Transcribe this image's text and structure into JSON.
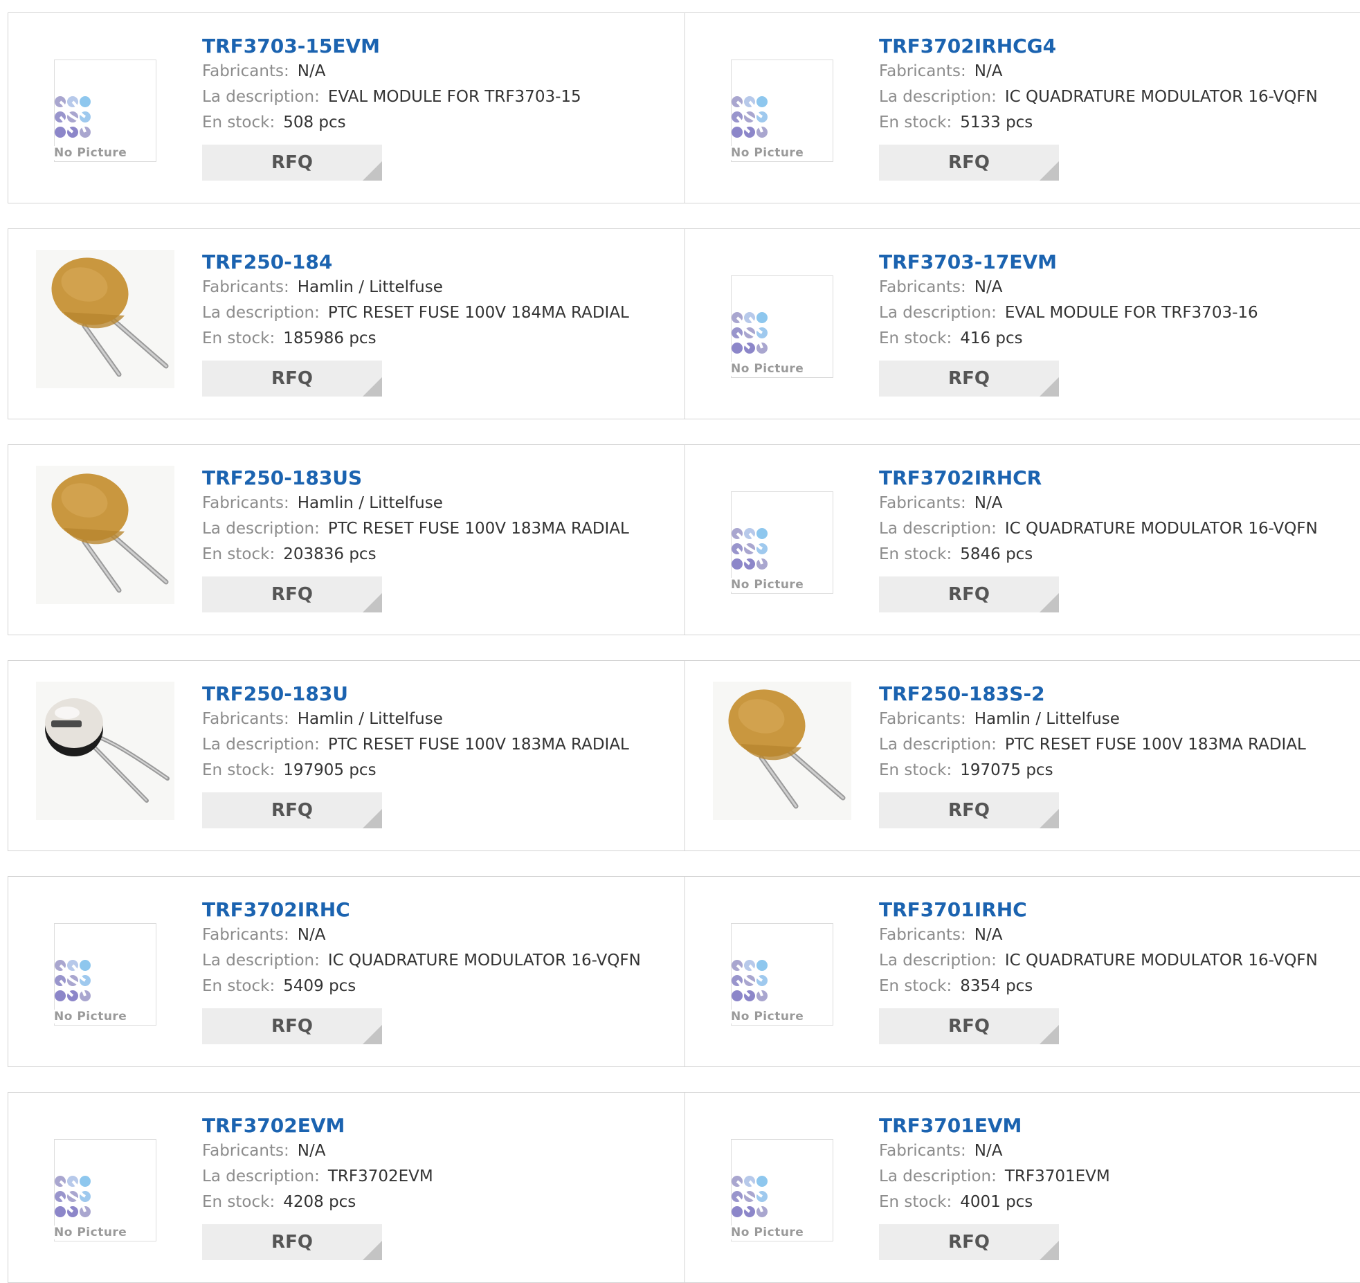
{
  "labels": {
    "manufacturer": "Fabricants:",
    "description": "La description:",
    "stock": "En stock:",
    "rfq": "RFQ",
    "no_picture": "No Picture"
  },
  "products": [
    {
      "part": "TRF3703-15EVM",
      "manufacturer": "N/A",
      "description": "EVAL MODULE FOR TRF3703-15",
      "stock": "508 pcs",
      "image": "no-picture"
    },
    {
      "part": "TRF3702IRHCG4",
      "manufacturer": "N/A",
      "description": "IC QUADRATURE MODULATOR 16-VQFN",
      "stock": "5133 pcs",
      "image": "no-picture"
    },
    {
      "part": "TRF250-184",
      "manufacturer": "Hamlin / Littelfuse",
      "description": "PTC RESET FUSE 100V 184MA RADIAL",
      "stock": "185986 pcs",
      "image": "ptc-fuse-yellow"
    },
    {
      "part": "TRF3703-17EVM",
      "manufacturer": "N/A",
      "description": "EVAL MODULE FOR TRF3703-16",
      "stock": "416 pcs",
      "image": "no-picture"
    },
    {
      "part": "TRF250-183US",
      "manufacturer": "Hamlin / Littelfuse",
      "description": "PTC RESET FUSE 100V 183MA RADIAL",
      "stock": "203836 pcs",
      "image": "ptc-fuse-yellow"
    },
    {
      "part": "TRF3702IRHCR",
      "manufacturer": "N/A",
      "description": "IC QUADRATURE MODULATOR 16-VQFN",
      "stock": "5846 pcs",
      "image": "no-picture"
    },
    {
      "part": "TRF250-183U",
      "manufacturer": "Hamlin / Littelfuse",
      "description": "PTC RESET FUSE 100V 183MA RADIAL",
      "stock": "197905 pcs",
      "image": "ptc-fuse-white"
    },
    {
      "part": "TRF250-183S-2",
      "manufacturer": "Hamlin / Littelfuse",
      "description": "PTC RESET FUSE 100V 183MA RADIAL",
      "stock": "197075 pcs",
      "image": "ptc-fuse-yellow"
    },
    {
      "part": "TRF3702IRHC",
      "manufacturer": "N/A",
      "description": "IC QUADRATURE MODULATOR 16-VQFN",
      "stock": "5409 pcs",
      "image": "no-picture"
    },
    {
      "part": "TRF3701IRHC",
      "manufacturer": "N/A",
      "description": "IC QUADRATURE MODULATOR 16-VQFN",
      "stock": "8354 pcs",
      "image": "no-picture"
    },
    {
      "part": "TRF3702EVM",
      "manufacturer": "N/A",
      "description": "TRF3702EVM",
      "stock": "4208 pcs",
      "image": "no-picture"
    },
    {
      "part": "TRF3701EVM",
      "manufacturer": "N/A",
      "description": "TRF3701EVM",
      "stock": "4001 pcs",
      "image": "no-picture"
    }
  ],
  "colors": {
    "title": "#1b63b0",
    "label": "#8c8c8c",
    "value": "#333333",
    "rfq_bg": "#ededed",
    "border": "#d3d3d3",
    "fuse_yellow": "#c9973f",
    "fuse_white": "#e6e2dc",
    "logo_dark": "#8c86c9",
    "logo_light": "#8ec7ee"
  }
}
